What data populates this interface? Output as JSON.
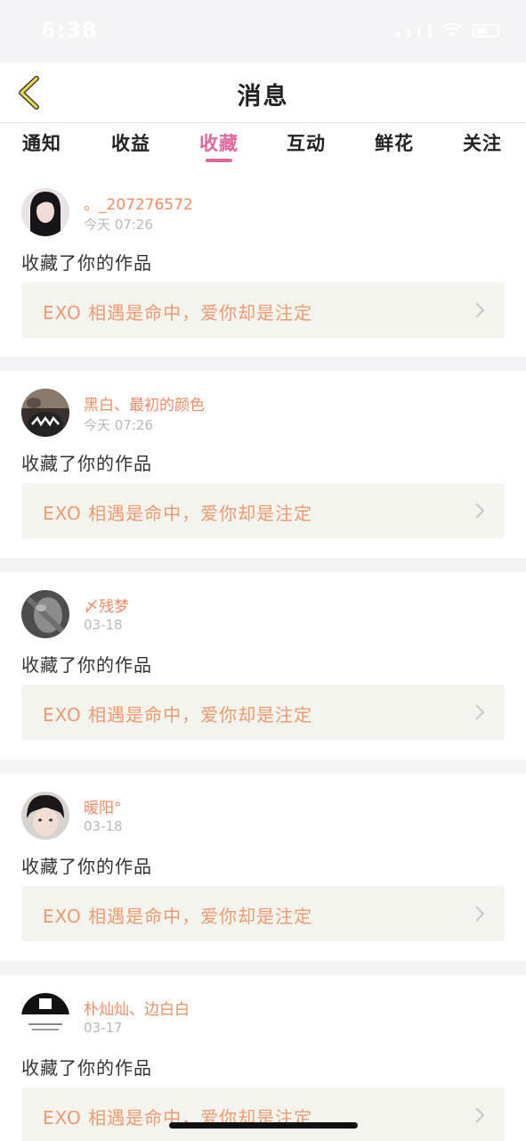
{
  "status_bar": {
    "time": "6:38"
  },
  "nav": {
    "title": "消息"
  },
  "tabs": [
    {
      "label": "通知"
    },
    {
      "label": "收益"
    },
    {
      "label": "收藏",
      "active": true
    },
    {
      "label": "互动"
    },
    {
      "label": "鲜花"
    },
    {
      "label": "关注"
    }
  ],
  "messages": [
    {
      "user": "。_207276572",
      "time": "今天 07:26",
      "action": "收藏了你的作品",
      "work": "EXO 相遇是命中，爱你却是注定"
    },
    {
      "user": "黑白、最初的颜色",
      "time": "今天 07:26",
      "action": "收藏了你的作品",
      "work": "EXO 相遇是命中，爱你却是注定"
    },
    {
      "user": "〆残梦",
      "time": "03-18",
      "action": "收藏了你的作品",
      "work": "EXO 相遇是命中，爱你却是注定"
    },
    {
      "user": "暖阳°",
      "time": "03-18",
      "action": "收藏了你的作品",
      "work": "EXO 相遇是命中，爱你却是注定"
    },
    {
      "user": "朴灿灿、边白白",
      "time": "03-17",
      "action": "收藏了你的作品",
      "work": "EXO 相遇是命中，爱你却是注定"
    }
  ],
  "colors": {
    "accent": "#e1689c",
    "username": "#ef8c63",
    "link_text": "#ef9a6e"
  }
}
